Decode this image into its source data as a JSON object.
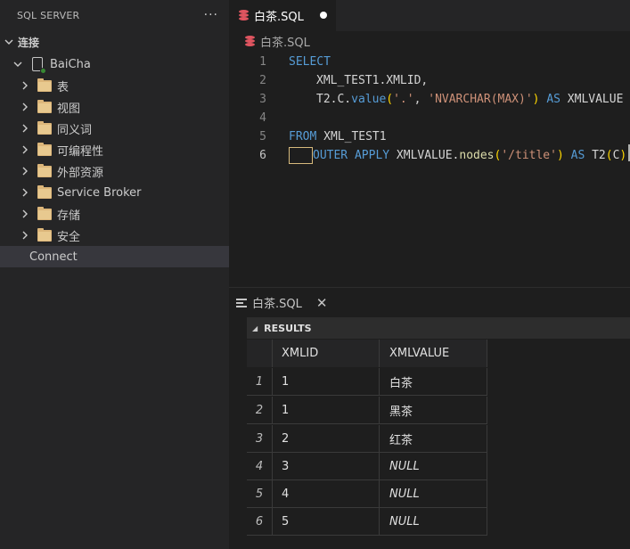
{
  "sidebar": {
    "title": "SQL SERVER",
    "more": "···",
    "section": "连接",
    "server": "BaiCha",
    "folders": [
      "表",
      "视图",
      "同义词",
      "可编程性",
      "外部资源",
      "Service Broker",
      "存储",
      "安全"
    ],
    "connect": "Connect"
  },
  "editor": {
    "tab_label": "白茶.SQL",
    "breadcrumb": "白茶.SQL",
    "line_numbers": [
      "1",
      "2",
      "3",
      "4",
      "5",
      "6"
    ],
    "tokens": {
      "select": "SELECT",
      "l2_ident": "XML_TEST1.XMLID,",
      "l3_t2": "T2.C.",
      "l3_value": "value",
      "l3_open": "(",
      "l3_str1": "'.'",
      "l3_comma": ", ",
      "l3_str2": "'NVARCHAR(MAX)'",
      "l3_close": ")",
      "l3_as": "AS",
      "l3_alias": "XMLVALUE",
      "from": "FROM",
      "l5_table": "XML_TEST1",
      "outer_apply": "OUTER APPLY",
      "l6_xml": "XMLVALUE.",
      "l6_nodes": "nodes",
      "l6_open": "(",
      "l6_str": "'/title'",
      "l6_close": ")",
      "l6_as": "AS",
      "l6_t2": "T2",
      "l6_open2": "(",
      "l6_c": "C",
      "l6_close2": ")"
    }
  },
  "results": {
    "tab_label": "白茶.SQL",
    "close_glyph": "✕",
    "section": "RESULTS",
    "columns": [
      "XMLID",
      "XMLVALUE"
    ],
    "rows": [
      {
        "n": "1",
        "id": "1",
        "value": "白茶"
      },
      {
        "n": "2",
        "id": "1",
        "value": "黑茶"
      },
      {
        "n": "3",
        "id": "2",
        "value": "红茶"
      },
      {
        "n": "4",
        "id": "3",
        "value": "NULL"
      },
      {
        "n": "5",
        "id": "4",
        "value": "NULL"
      },
      {
        "n": "6",
        "id": "5",
        "value": "NULL"
      }
    ]
  },
  "colors": {
    "keyword": "#569cd6",
    "function": "#dcdcaa",
    "string": "#ce9178",
    "bracket": "#ffd700",
    "folder": "#dcb67a",
    "connected": "#388a34"
  }
}
